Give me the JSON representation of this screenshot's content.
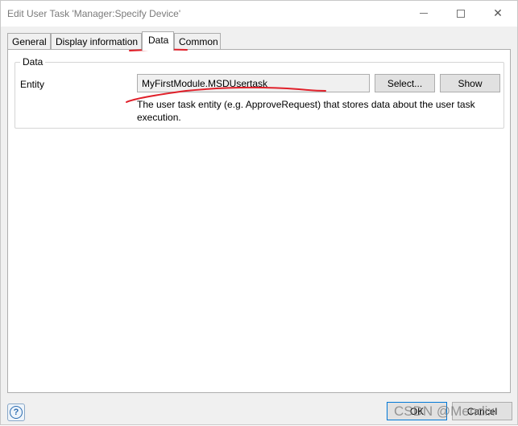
{
  "window": {
    "title": "Edit User Task 'Manager:Specify Device'",
    "minimize_glyph": "—",
    "maximize_glyph": "☐",
    "close_glyph": "✕"
  },
  "tabs": [
    {
      "label": "General",
      "active": false
    },
    {
      "label": "Display information",
      "active": false
    },
    {
      "label": "Data",
      "active": true
    },
    {
      "label": "Common",
      "active": false
    }
  ],
  "data_group": {
    "title": "Data",
    "entity_label": "Entity",
    "entity_value": "MyFirstModule.MSDUsertask",
    "select_button": "Select...",
    "show_button": "Show",
    "help_text": "The user task entity (e.g. ApproveRequest) that stores data about the user task execution."
  },
  "footer": {
    "help_glyph": "?",
    "ok_button": "OK",
    "cancel_button": "Cancel"
  },
  "watermark": "CSDN @Mendix",
  "annotation_color": "#e0202a"
}
